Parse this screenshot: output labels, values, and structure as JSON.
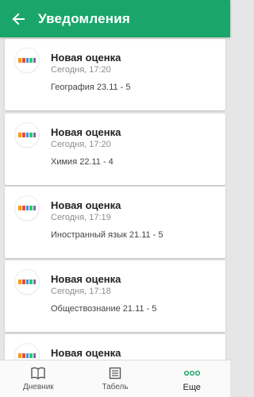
{
  "appbar": {
    "title": "Уведомления",
    "back_icon": "arrow-left-icon"
  },
  "colors": {
    "primary": "#1aa66a",
    "background": "#e6e6e6"
  },
  "notifications": [
    {
      "title": "Новая оценка",
      "time": "Сегодня, 17:20",
      "body": "География 23.11 - 5",
      "icon": "eschool-logo-icon"
    },
    {
      "title": "Новая оценка",
      "time": "Сегодня, 17:20",
      "body": "Химия 22.11 - 4",
      "icon": "eschool-logo-icon"
    },
    {
      "title": "Новая оценка",
      "time": "Сегодня, 17:19",
      "body": "Иностранный язык 21.11 - 5",
      "icon": "eschool-logo-icon"
    },
    {
      "title": "Новая оценка",
      "time": "Сегодня, 17:18",
      "body": "Обществознание 21.11 - 5",
      "icon": "eschool-logo-icon"
    },
    {
      "title": "Новая оценка",
      "time": "",
      "body": "",
      "icon": "eschool-logo-icon"
    }
  ],
  "bottom_nav": {
    "items": [
      {
        "label": "Дневник",
        "icon": "book-icon",
        "active": false
      },
      {
        "label": "Табель",
        "icon": "report-card-icon",
        "active": false
      },
      {
        "label": "Еще",
        "icon": "more-dots-icon",
        "active": true
      }
    ]
  }
}
